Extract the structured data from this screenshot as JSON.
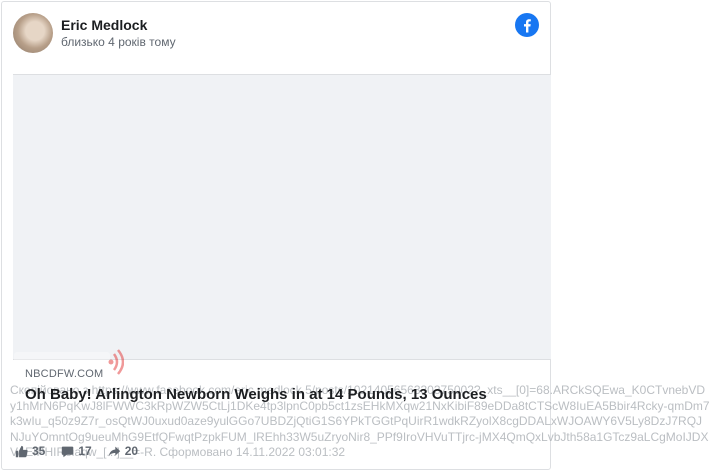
{
  "post": {
    "author": "Eric Medlock",
    "time": "близько 4 років тому",
    "link_domain": "NBCDFW.COM",
    "link_title": "Oh Baby! Arlington Newborn Weighs in at 14 Pounds, 13 Ounces"
  },
  "stats": {
    "likes": "35",
    "comments": "17",
    "shares": "20"
  },
  "footer_text": "Скопійовано з https://www.facebook.com/eric.medlock.5/posts/1021405656330375002?_xts__[0]=68.ARCkSQEwa_K0CTvnebVDy1hMrN6PqKwJ8lFWWC3kRpWZW5CtLj1DKe4tp3lpnC0pb5ct1zsEHkMXqw21NxKibiF89eDDa8tCTScW8IuEA5Bbir4Rcky-qmDm7k3wIu_q50z9Z7r_osQtWJ0uxud0aze9yulGGo7UBDZjQtiG1S6YPkTGGtPqUirR1wdkRZyolX8cgDDALxWJOAWY6V5Ly8DzJ7RQJNJuYOmntOg9ueuMhG9EtfQFwqtPzpkFUM_lREhh33W5uZryoNir8_PPf9IroVHVuTTjrc-jMX4QmQxLvbJth58a1GTcz9aLCgMoIJDXVAEIPHIReiaqw_[...]__=-R. Сформовано 14.11.2022 03:01:32",
  "icons": {
    "brand": "facebook-icon",
    "like": "thumbs-up-icon",
    "comment": "comment-icon",
    "share": "share-icon"
  },
  "colors": {
    "facebook_blue": "#1877f2",
    "watermark_red": "#e02020"
  }
}
